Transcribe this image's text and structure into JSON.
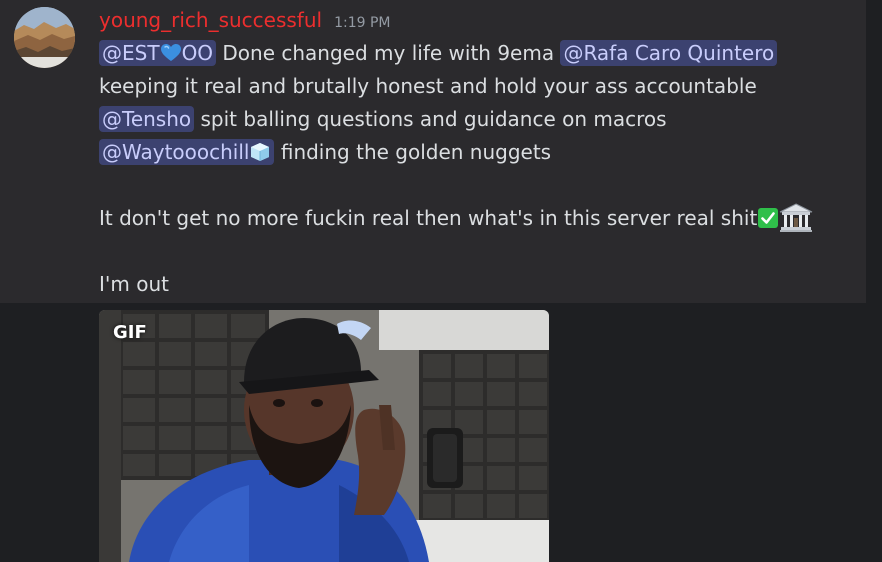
{
  "message": {
    "author": "young_rich_successful",
    "timestamp": "1:19 PM",
    "author_color": "#ec2e2e",
    "lines": {
      "l1_mention_a": "@EST",
      "l1_mention_a_suffix": "OO",
      "l1_text": " Done changed my life with 9ema ",
      "l1_mention_b": "@Rafa Caro Quintero",
      "l2_text": "keeping it real and brutally honest and hold your ass accountable",
      "l3_mention": "@Tensho",
      "l3_text": " spit balling questions and guidance on macros",
      "l4_mention": "@Waytooochill",
      "l4_text": " finding the golden nuggets",
      "l5_text": "It don't get no more fuckin real then what's in this server real shit",
      "l6_text": "I'm out"
    },
    "emoji": {
      "blue_heart": "blue-heart-icon",
      "ice_cube": "ice-cube-icon",
      "check_mark": "white-check-mark-icon",
      "bank": "bank-icon"
    },
    "attachment": {
      "badge": "GIF"
    }
  },
  "colors": {
    "background": "#1e1f22",
    "message_highlight": "#2b2a2d",
    "mention_bg": "#3c4270",
    "mention_fg": "#c9cdfb",
    "text": "#dbdee1",
    "timestamp": "#949ba4"
  }
}
